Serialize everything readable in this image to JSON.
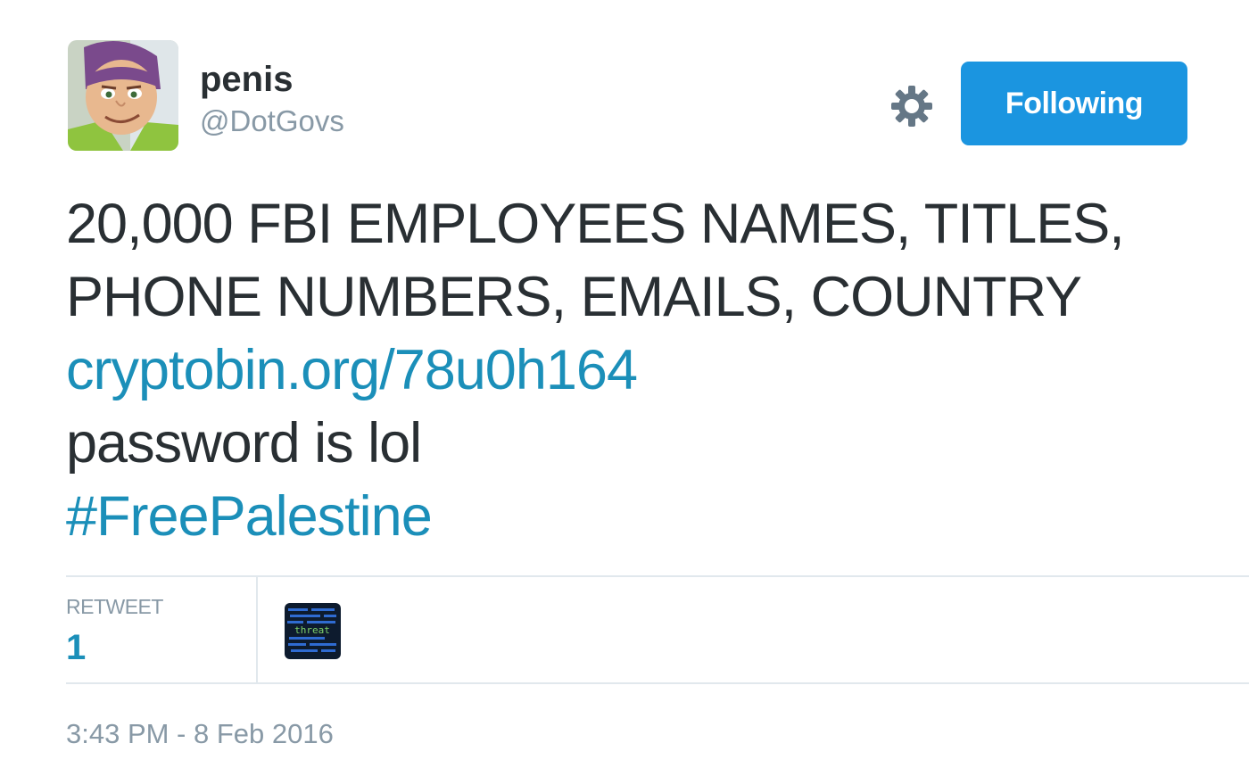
{
  "author": {
    "display_name": "penis",
    "screen_name": "@DotGovs",
    "avatar_icon": "cartoon-space-ranger-avatar"
  },
  "actions": {
    "gear_icon": "gear-icon",
    "follow_label": "Following"
  },
  "tweet": {
    "line1": "20,000 FBI EMPLOYEES NAMES, TITLES,",
    "line2": "PHONE NUMBERS, EMAILS, COUNTRY",
    "link": "cryptobin.org/78u0h164",
    "line3": "password is lol",
    "hashtag": "#FreePalestine"
  },
  "stats": {
    "retweet_label": "RETWEET",
    "retweet_count": "1",
    "retweeter_avatar_text": "threat"
  },
  "timestamp": "3:43 PM - 8 Feb 2016",
  "colors": {
    "follow_button": "#1b95e0",
    "link": "#1b8fb9",
    "muted": "#8899a6",
    "text": "#292f33",
    "divider": "#e1e8ed"
  }
}
